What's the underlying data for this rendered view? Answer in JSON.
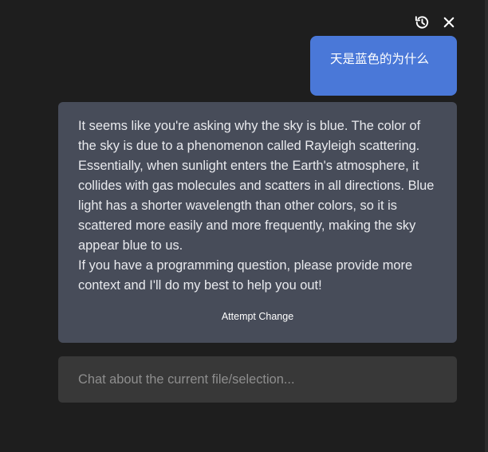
{
  "toolbar": {
    "history_icon": "history-icon",
    "close_icon": "close-icon"
  },
  "conversation": {
    "user_message": "天是蓝色的为什么",
    "assistant_message": {
      "paragraphs": [
        "It seems like you're asking why the sky is blue. The color of the sky is due to a phenomenon called Rayleigh scattering. Essentially, when sunlight enters the Earth's atmosphere, it collides with gas molecules and scatters in all directions. Blue light has a shorter wavelength than other colors, so it is scattered more easily and more frequently, making the sky appear blue to us.",
        "If you have a programming question, please provide more context and I'll do my best to help you out!"
      ],
      "action_label": "Attempt Change"
    }
  },
  "input": {
    "placeholder": "Chat about the current file/selection..."
  },
  "colors": {
    "background": "#1e1e1e",
    "user_bubble": "#4a78d8",
    "assistant_bubble": "#474c59",
    "input_background": "#383838"
  }
}
